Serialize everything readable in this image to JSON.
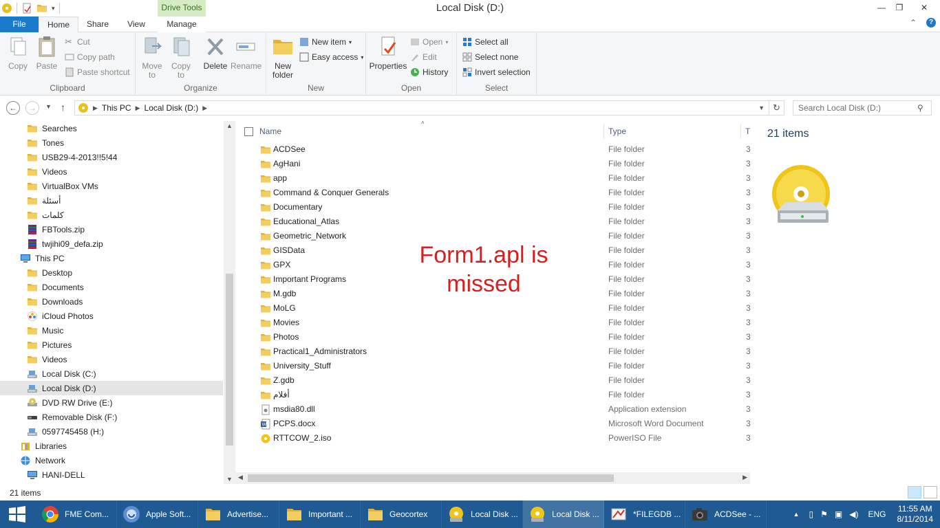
{
  "window": {
    "title": "Local Disk (D:)",
    "context_tab_group": "Drive Tools",
    "controls": {
      "minimize": "—",
      "restore": "❐",
      "close": "✕"
    }
  },
  "ribbon_tabs": [
    "File",
    "Home",
    "Share",
    "View",
    "Manage"
  ],
  "ribbon": {
    "clipboard": {
      "label": "Clipboard",
      "copy": "Copy",
      "paste": "Paste",
      "cut": "Cut",
      "copy_path": "Copy path",
      "paste_shortcut": "Paste shortcut"
    },
    "organize": {
      "label": "Organize",
      "move_to": "Move to",
      "copy_to": "Copy to",
      "delete": "Delete",
      "rename": "Rename"
    },
    "new": {
      "label": "New",
      "new_folder": "New folder",
      "new_item": "New item",
      "easy_access": "Easy access"
    },
    "open": {
      "label": "Open",
      "properties": "Properties",
      "open": "Open",
      "edit": "Edit",
      "history": "History"
    },
    "select": {
      "label": "Select",
      "select_all": "Select all",
      "select_none": "Select none",
      "invert_selection": "Invert selection"
    }
  },
  "address": {
    "crumbs": [
      "This PC",
      "Local Disk (D:)"
    ],
    "search_placeholder": "Search Local Disk (D:)"
  },
  "nav_tree": [
    {
      "label": "Searches",
      "icon": "folder-icon",
      "indent": 1
    },
    {
      "label": "Tones",
      "icon": "folder-icon",
      "indent": 1
    },
    {
      "label": "USB29-4-2013!!5!44",
      "icon": "folder-icon",
      "indent": 1
    },
    {
      "label": "Videos",
      "icon": "folder-icon",
      "indent": 1
    },
    {
      "label": "VirtualBox VMs",
      "icon": "folder-icon",
      "indent": 1
    },
    {
      "label": "أسئلة",
      "icon": "folder-icon",
      "indent": 1
    },
    {
      "label": "كلمات",
      "icon": "folder-icon",
      "indent": 1
    },
    {
      "label": "FBTools.zip",
      "icon": "archive-icon",
      "indent": 1
    },
    {
      "label": "twjihi09_defa.zip",
      "icon": "archive-icon",
      "indent": 1
    },
    {
      "label": "This PC",
      "icon": "computer-icon",
      "indent": 0
    },
    {
      "label": "Desktop",
      "icon": "folder-icon",
      "indent": 1
    },
    {
      "label": "Documents",
      "icon": "folder-icon",
      "indent": 1
    },
    {
      "label": "Downloads",
      "icon": "folder-icon",
      "indent": 1
    },
    {
      "label": "iCloud Photos",
      "icon": "icloud-photos-icon",
      "indent": 1
    },
    {
      "label": "Music",
      "icon": "folder-icon",
      "indent": 1
    },
    {
      "label": "Pictures",
      "icon": "folder-icon",
      "indent": 1
    },
    {
      "label": "Videos",
      "icon": "folder-icon",
      "indent": 1
    },
    {
      "label": "Local Disk (C:)",
      "icon": "drive-icon",
      "indent": 1
    },
    {
      "label": "Local Disk (D:)",
      "icon": "drive-icon",
      "indent": 1,
      "selected": true
    },
    {
      "label": "DVD RW Drive (E:)",
      "icon": "dvd-drive-icon",
      "indent": 1
    },
    {
      "label": "Removable Disk (F:)",
      "icon": "removable-disk-icon",
      "indent": 1
    },
    {
      "label": "0597745458 (H:)",
      "icon": "drive-icon",
      "indent": 1
    },
    {
      "label": "Libraries",
      "icon": "libraries-icon",
      "indent": 0
    },
    {
      "label": "Network",
      "icon": "network-icon",
      "indent": 0
    },
    {
      "label": "HANI-DELL",
      "icon": "computer-icon",
      "indent": 1
    }
  ],
  "columns": {
    "name": "Name",
    "type": "Type",
    "size": "T"
  },
  "files": [
    {
      "name": "ACDSee",
      "type": "File folder",
      "icon": "folder-icon"
    },
    {
      "name": "AgHani",
      "type": "File folder",
      "icon": "folder-icon"
    },
    {
      "name": "app",
      "type": "File folder",
      "icon": "folder-icon"
    },
    {
      "name": "Command & Conquer Generals",
      "type": "File folder",
      "icon": "folder-icon"
    },
    {
      "name": "Documentary",
      "type": "File folder",
      "icon": "folder-icon"
    },
    {
      "name": "Educational_Atlas",
      "type": "File folder",
      "icon": "folder-icon"
    },
    {
      "name": "Geometric_Network",
      "type": "File folder",
      "icon": "folder-icon"
    },
    {
      "name": "GISData",
      "type": "File folder",
      "icon": "folder-icon"
    },
    {
      "name": "GPX",
      "type": "File folder",
      "icon": "folder-icon"
    },
    {
      "name": "Important Programs",
      "type": "File folder",
      "icon": "folder-icon"
    },
    {
      "name": "M.gdb",
      "type": "File folder",
      "icon": "folder-icon"
    },
    {
      "name": "MoLG",
      "type": "File folder",
      "icon": "folder-icon"
    },
    {
      "name": "Movies",
      "type": "File folder",
      "icon": "folder-icon"
    },
    {
      "name": "Photos",
      "type": "File folder",
      "icon": "folder-icon"
    },
    {
      "name": "Practical1_Administrators",
      "type": "File folder",
      "icon": "folder-icon"
    },
    {
      "name": "University_Stuff",
      "type": "File folder",
      "icon": "folder-icon"
    },
    {
      "name": "Z.gdb",
      "type": "File folder",
      "icon": "folder-icon"
    },
    {
      "name": "أفلام",
      "type": "File folder",
      "icon": "folder-icon"
    },
    {
      "name": "msdia80.dll",
      "type": "Application extension",
      "icon": "dll-icon"
    },
    {
      "name": "PCPS.docx",
      "type": "Microsoft Word Document",
      "icon": "word-icon"
    },
    {
      "name": "RTTCOW_2.iso",
      "type": "PowerISO File",
      "icon": "iso-icon"
    }
  ],
  "row_trailing": "3",
  "annotation": {
    "line1": "Form1.apl is",
    "line2": "missed",
    "color": "#d42020"
  },
  "details": {
    "count": "21 items"
  },
  "status": {
    "count": "21 items"
  },
  "taskbar": {
    "items": [
      {
        "label": "FME Com...",
        "icon": "chrome-icon"
      },
      {
        "label": "Apple Soft...",
        "icon": "apple-software-icon"
      },
      {
        "label": "Advertise...",
        "icon": "folder-icon"
      },
      {
        "label": "Important ...",
        "icon": "folder-icon"
      },
      {
        "label": "Geocortex",
        "icon": "folder-icon"
      },
      {
        "label": "Local Disk ...",
        "icon": "drive-icon"
      },
      {
        "label": "Local Disk ...",
        "icon": "drive-icon"
      },
      {
        "label": "*FILEGDB ...",
        "icon": "fme-icon"
      },
      {
        "label": "ACDSee - ...",
        "icon": "acdsee-icon"
      }
    ],
    "lang": "ENG",
    "time": "11:55 AM",
    "date": "8/11/2014"
  },
  "colors": {
    "accent": "#1979ca",
    "taskbar": "#1f5a92",
    "folder": "#e8b534",
    "drive_tools": "#d5ebc4"
  }
}
